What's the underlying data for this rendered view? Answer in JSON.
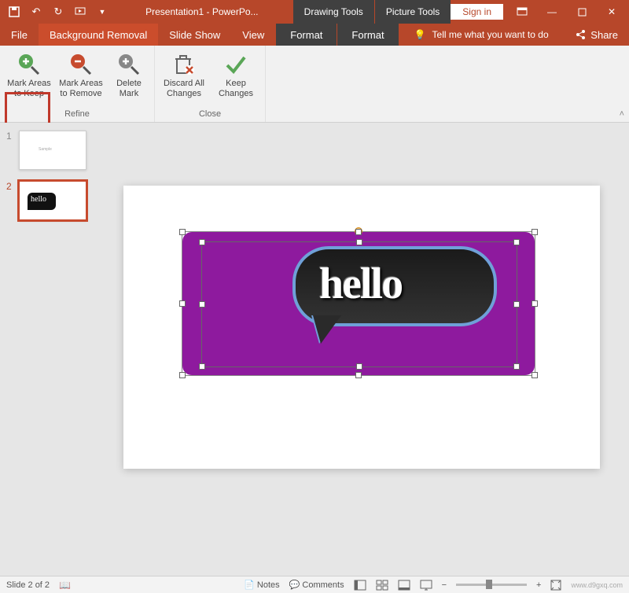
{
  "titlebar": {
    "title": "Presentation1 - PowerPo...",
    "context1": "Drawing Tools",
    "context2": "Picture Tools",
    "signin": "Sign in"
  },
  "tabs": {
    "file": "File",
    "bg_removal": "Background Removal",
    "slideshow": "Slide Show",
    "view": "View",
    "format1": "Format",
    "format2": "Format",
    "tellme": "Tell me what you want to do",
    "share": "Share"
  },
  "ribbon": {
    "mark_keep": "Mark Areas to Keep",
    "mark_remove": "Mark Areas to Remove",
    "delete_mark": "Delete Mark",
    "discard": "Discard All Changes",
    "keep": "Keep Changes",
    "group_refine": "Refine",
    "group_close": "Close"
  },
  "thumbs": {
    "n1": "1",
    "n2": "2"
  },
  "slide": {
    "hello": "hello"
  },
  "status": {
    "slide": "Slide 2 of 2",
    "notes": "Notes",
    "comments": "Comments",
    "zoom_out": "−",
    "zoom_in": "+"
  },
  "watermark": "www.d9gxq.com"
}
